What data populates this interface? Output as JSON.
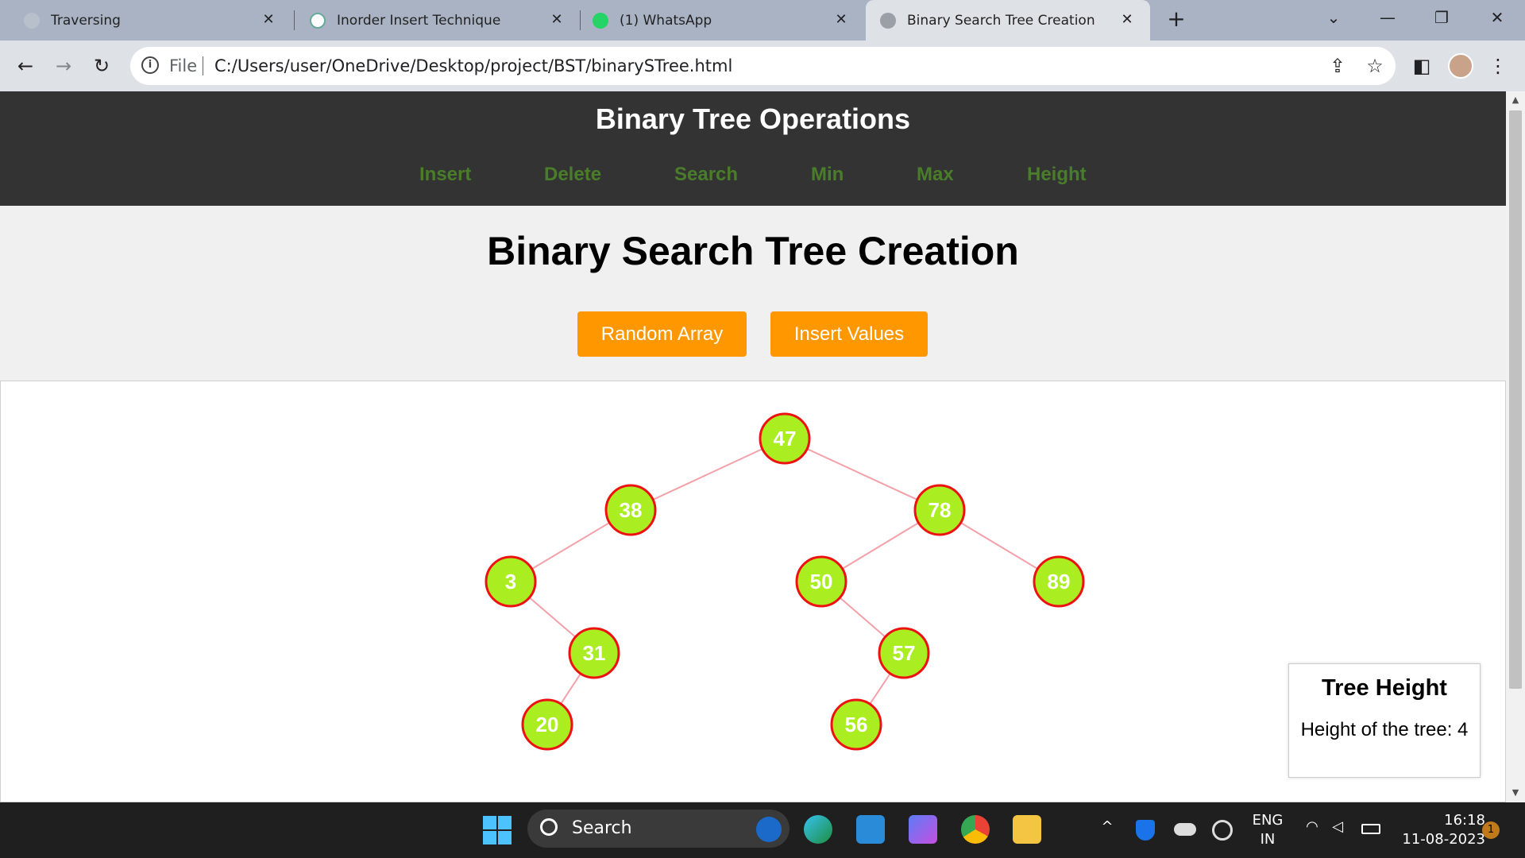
{
  "browser": {
    "tabs": [
      {
        "label": "Traversing",
        "favicon": "globe-icon"
      },
      {
        "label": "Inorder Insert Technique",
        "favicon": "chatgpt-icon"
      },
      {
        "label": "(1) WhatsApp",
        "favicon": "whatsapp-icon"
      },
      {
        "label": "Binary Search Tree Creation",
        "favicon": "globe-icon",
        "active": true
      }
    ],
    "new_tab": "+",
    "address": {
      "scheme": "File",
      "url": "C:/Users/user/OneDrive/Desktop/project/BST/binarySTree.html"
    }
  },
  "page": {
    "header_title": "Binary Tree Operations",
    "nav": [
      "Insert",
      "Delete",
      "Search",
      "Min",
      "Max",
      "Height"
    ],
    "title": "Binary Search Tree Creation",
    "buttons": {
      "random": "Random Array",
      "insert": "Insert Values"
    },
    "tree": {
      "nodes": [
        "47",
        "38",
        "78",
        "3",
        "50",
        "89",
        "31",
        "57",
        "20",
        "56"
      ],
      "node_fill": "#aaee22",
      "node_border": "#ee1111",
      "edge_color": "#f4a0a8"
    },
    "height_box": {
      "title": "Tree Height",
      "text": "Height of the tree: 4"
    }
  },
  "taskbar": {
    "search": "Search",
    "lang": "ENG",
    "region": "IN",
    "time": "16:18",
    "date": "11-08-2023",
    "notifications": "1"
  },
  "colors": {
    "accent": "#ff9800",
    "header_bg": "#333333",
    "nav_link": "#4a7d2a"
  }
}
